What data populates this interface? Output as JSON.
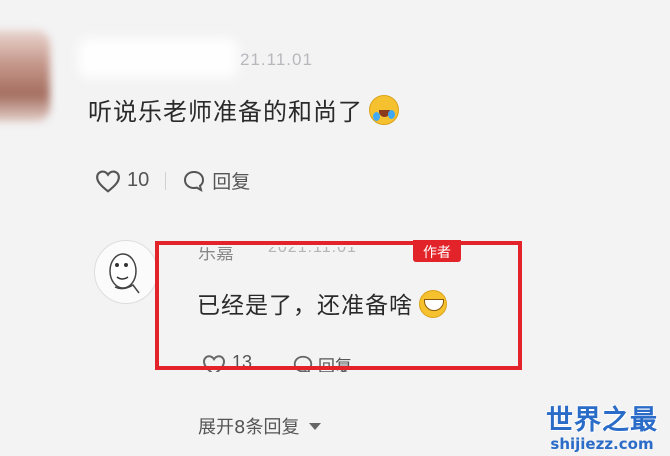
{
  "comment": {
    "date": "21.11.01",
    "text": "听说乐老师准备的和尚了",
    "emoji": "laugh-crying-emoji",
    "likes": "10",
    "reply_label": "回复"
  },
  "reply": {
    "author": "乐嘉",
    "date": "2021.11.01",
    "badge": "作者",
    "text": "已经是了，还准备啥",
    "emoji": "grin-emoji",
    "likes": "13",
    "reply_label": "回复"
  },
  "expand_label": "展开8条回复",
  "watermark": {
    "title": "世界之最",
    "url": "shijiezz.com"
  },
  "colors": {
    "highlight": "#e2232a",
    "watermark": "#2a6cc7"
  }
}
